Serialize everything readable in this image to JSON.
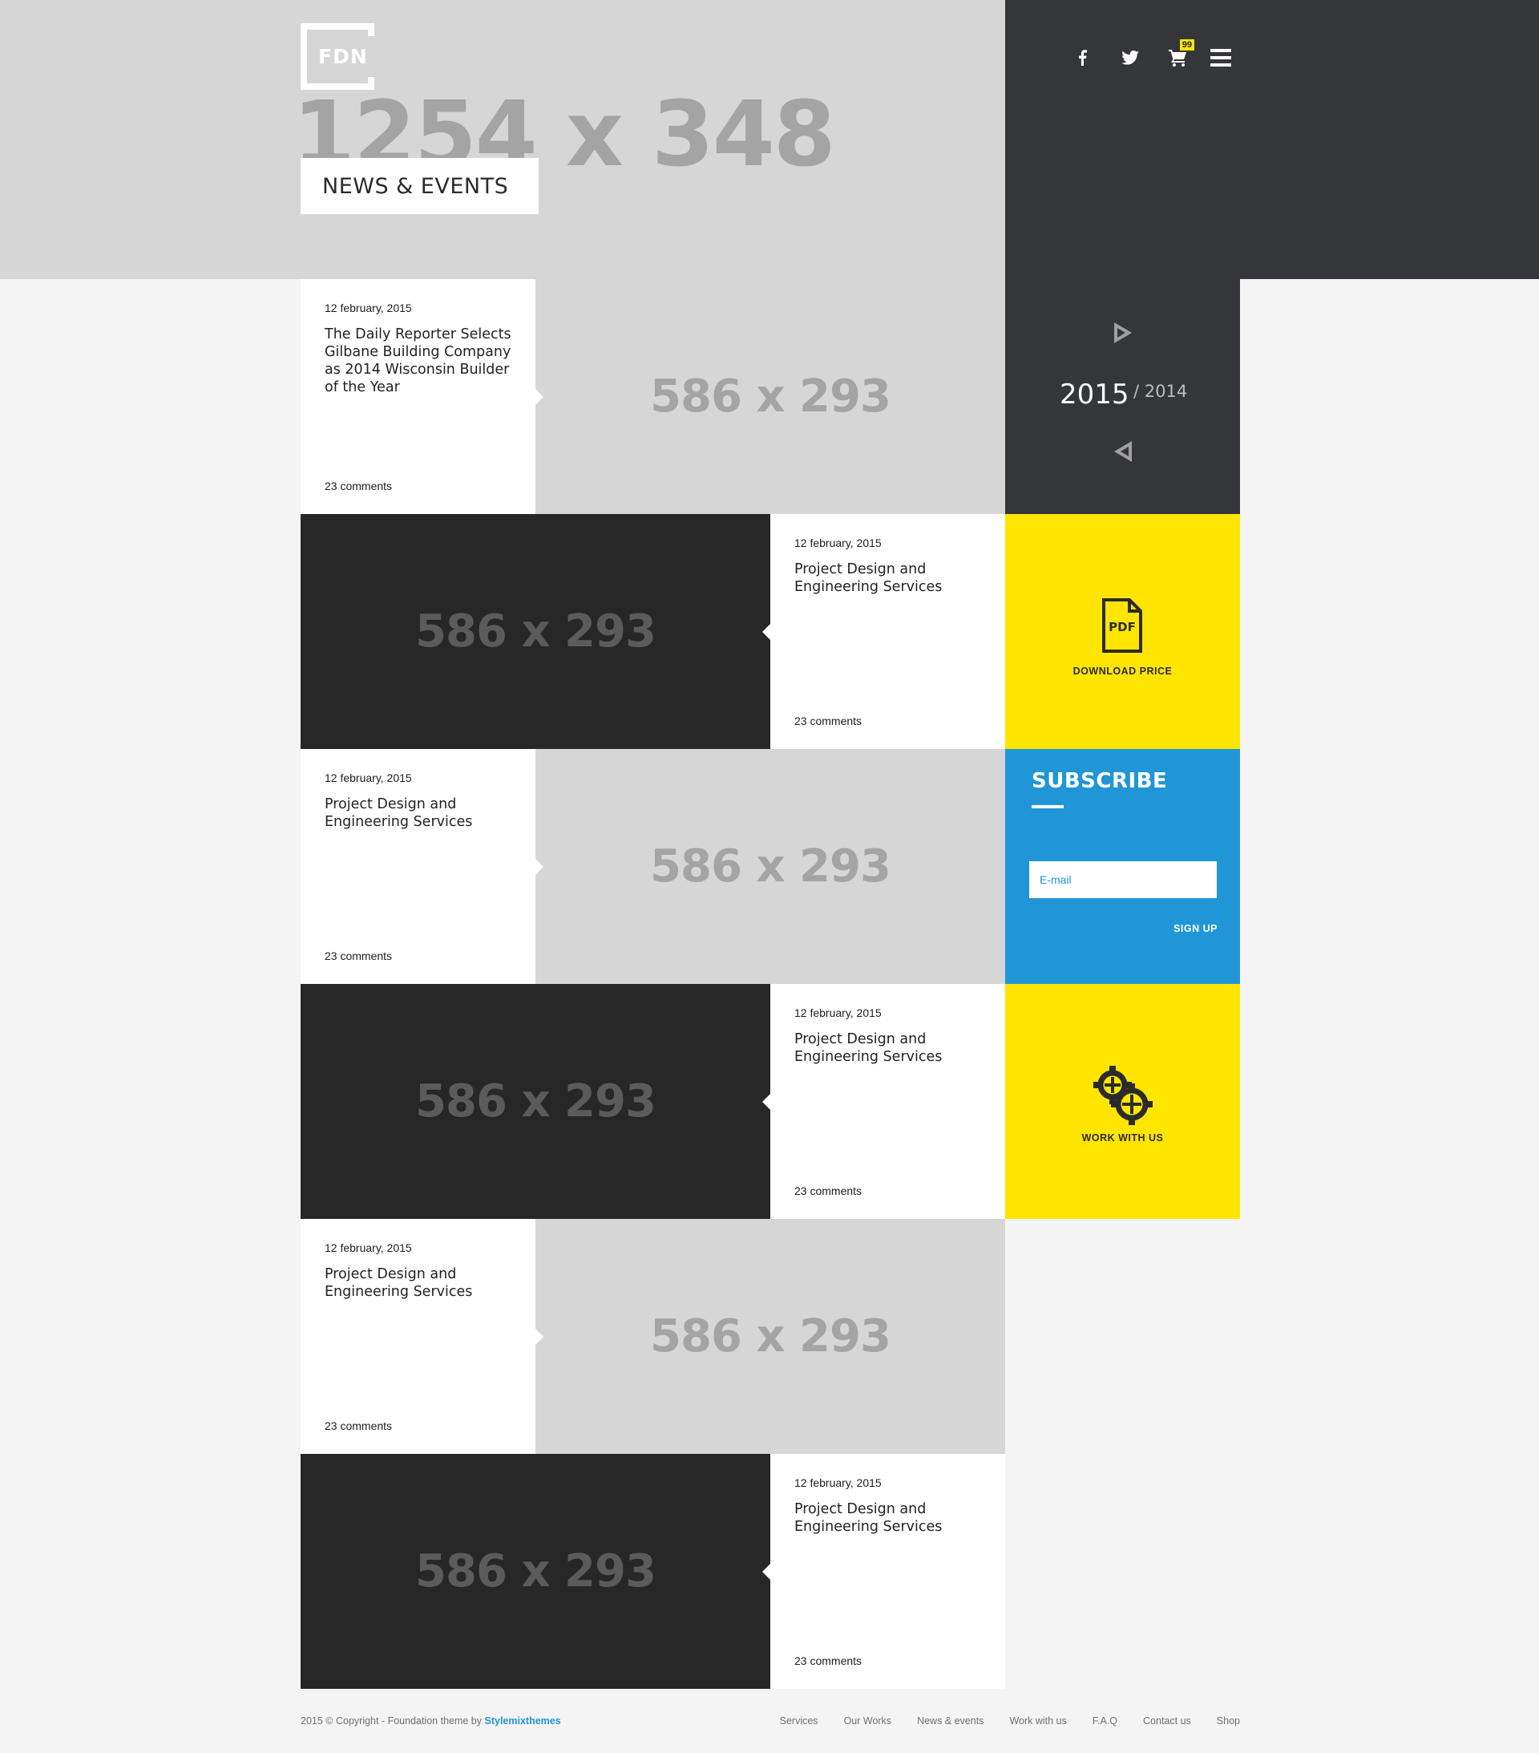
{
  "header": {
    "placeholder_text": "1254 x 348",
    "logo_text": "FDN",
    "page_title": "NEWS & EVENTS",
    "cart_badge": "99"
  },
  "icons": {
    "facebook": "facebook-icon",
    "twitter": "twitter-icon",
    "cart": "cart-icon",
    "menu": "hamburger-menu-icon"
  },
  "posts": [
    {
      "date": "12 february, 2015",
      "title": "The Daily Reporter Selects Gilbane Building Company as 2014 Wisconsin Builder of the Year",
      "comments": "23 comments",
      "image_label": "586 x 293"
    },
    {
      "date": "12 february, 2015",
      "title": "Project Design and Engineering Services",
      "comments": "23 comments",
      "image_label": "586 x 293"
    },
    {
      "date": "12 february, 2015",
      "title": "Project Design and Engineering Services",
      "comments": "23 comments",
      "image_label": "586 x 293"
    },
    {
      "date": "12 february, 2015",
      "title": "Project Design and Engineering Services",
      "comments": "23 comments",
      "image_label": "586 x 293"
    },
    {
      "date": "12 february, 2015",
      "title": "Project Design and Engineering Services",
      "comments": "23 comments",
      "image_label": "586 x 293"
    },
    {
      "date": "12 february, 2015",
      "title": "Project Design and Engineering Services",
      "comments": "23 comments",
      "image_label": "586 x 293"
    }
  ],
  "year_switcher": {
    "current": "2015",
    "other": "/ 2014"
  },
  "download": {
    "icon_text": "PDF",
    "label": "DOWNLOAD PRICE"
  },
  "subscribe": {
    "title": "SUBSCRIBE",
    "placeholder": "E-mail",
    "button": "SIGN UP"
  },
  "work": {
    "label": "WORK WITH US"
  },
  "footer": {
    "copyright": "2015 © Copyright - Foundation theme by",
    "brand": "Stylemixthemes",
    "links": [
      "Services",
      "Our Works",
      "News & events",
      "Work with us",
      "F.A.Q",
      "Contact us",
      "Shop"
    ]
  },
  "colors": {
    "accent_yellow": "#ffe500",
    "accent_blue": "#2196d6",
    "dark": "#35363a",
    "image_dark": "#272727",
    "image_light": "#d6d6d6"
  }
}
